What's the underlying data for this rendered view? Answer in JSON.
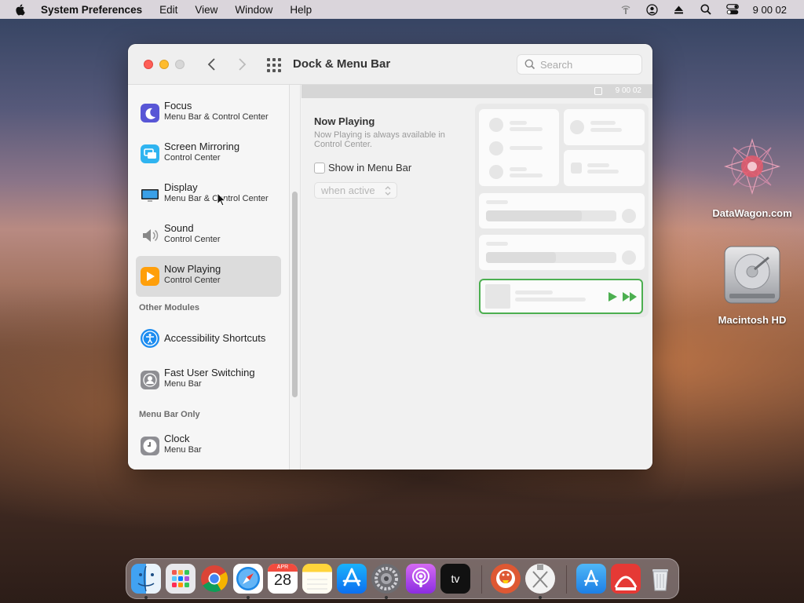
{
  "menubar": {
    "app_name": "System Preferences",
    "items": [
      "Edit",
      "View",
      "Window",
      "Help"
    ],
    "clock": "9 00 02"
  },
  "desktop": {
    "icons": [
      {
        "label": "DataWagon.com"
      },
      {
        "label": "Macintosh HD"
      }
    ]
  },
  "window": {
    "title": "Dock & Menu Bar",
    "search_placeholder": "Search"
  },
  "sidebar": {
    "items": [
      {
        "title": "Focus",
        "subtitle": "Menu Bar & Control Center",
        "icon": "moon-icon"
      },
      {
        "title": "Screen Mirroring",
        "subtitle": "Control Center",
        "icon": "screen-mirroring-icon"
      },
      {
        "title": "Display",
        "subtitle": "Menu Bar & Control Center",
        "icon": "display-icon"
      },
      {
        "title": "Sound",
        "subtitle": "Control Center",
        "icon": "speaker-icon"
      },
      {
        "title": "Now Playing",
        "subtitle": "Control Center",
        "icon": "play-icon",
        "selected": true
      }
    ],
    "other_heading": "Other Modules",
    "other_items": [
      {
        "title": "Accessibility Shortcuts",
        "subtitle": "",
        "icon": "accessibility-icon"
      },
      {
        "title": "Fast User Switching",
        "subtitle": "Menu Bar",
        "icon": "user-icon"
      }
    ],
    "menubar_heading": "Menu Bar Only",
    "menubar_items": [
      {
        "title": "Clock",
        "subtitle": "Menu Bar",
        "icon": "clock-icon"
      }
    ]
  },
  "content": {
    "strip_clock": "9 00 02",
    "heading": "Now Playing",
    "description": "Now Playing is always available in Control Center.",
    "checkbox_label": "Show in Menu Bar",
    "checkbox_checked": false,
    "dropdown_value": "when active",
    "help_label": "?"
  },
  "dock": {
    "apps": [
      "finder-icon",
      "launchpad-icon",
      "chrome-icon",
      "safari-icon",
      "calendar-icon",
      "notes-icon",
      "app-store-icon",
      "system-preferences-icon",
      "podcasts-icon",
      "apple-tv-icon",
      "duckduckgo-icon",
      "xcode-installer-icon",
      "applications-folder-icon",
      "ttrack-icon",
      "trash-icon"
    ],
    "calendar_month": "APR",
    "calendar_day": "28",
    "tv_label": "tv"
  },
  "colors": {
    "accent_green": "#4caf50",
    "selected_row": "#dcdcdc"
  }
}
